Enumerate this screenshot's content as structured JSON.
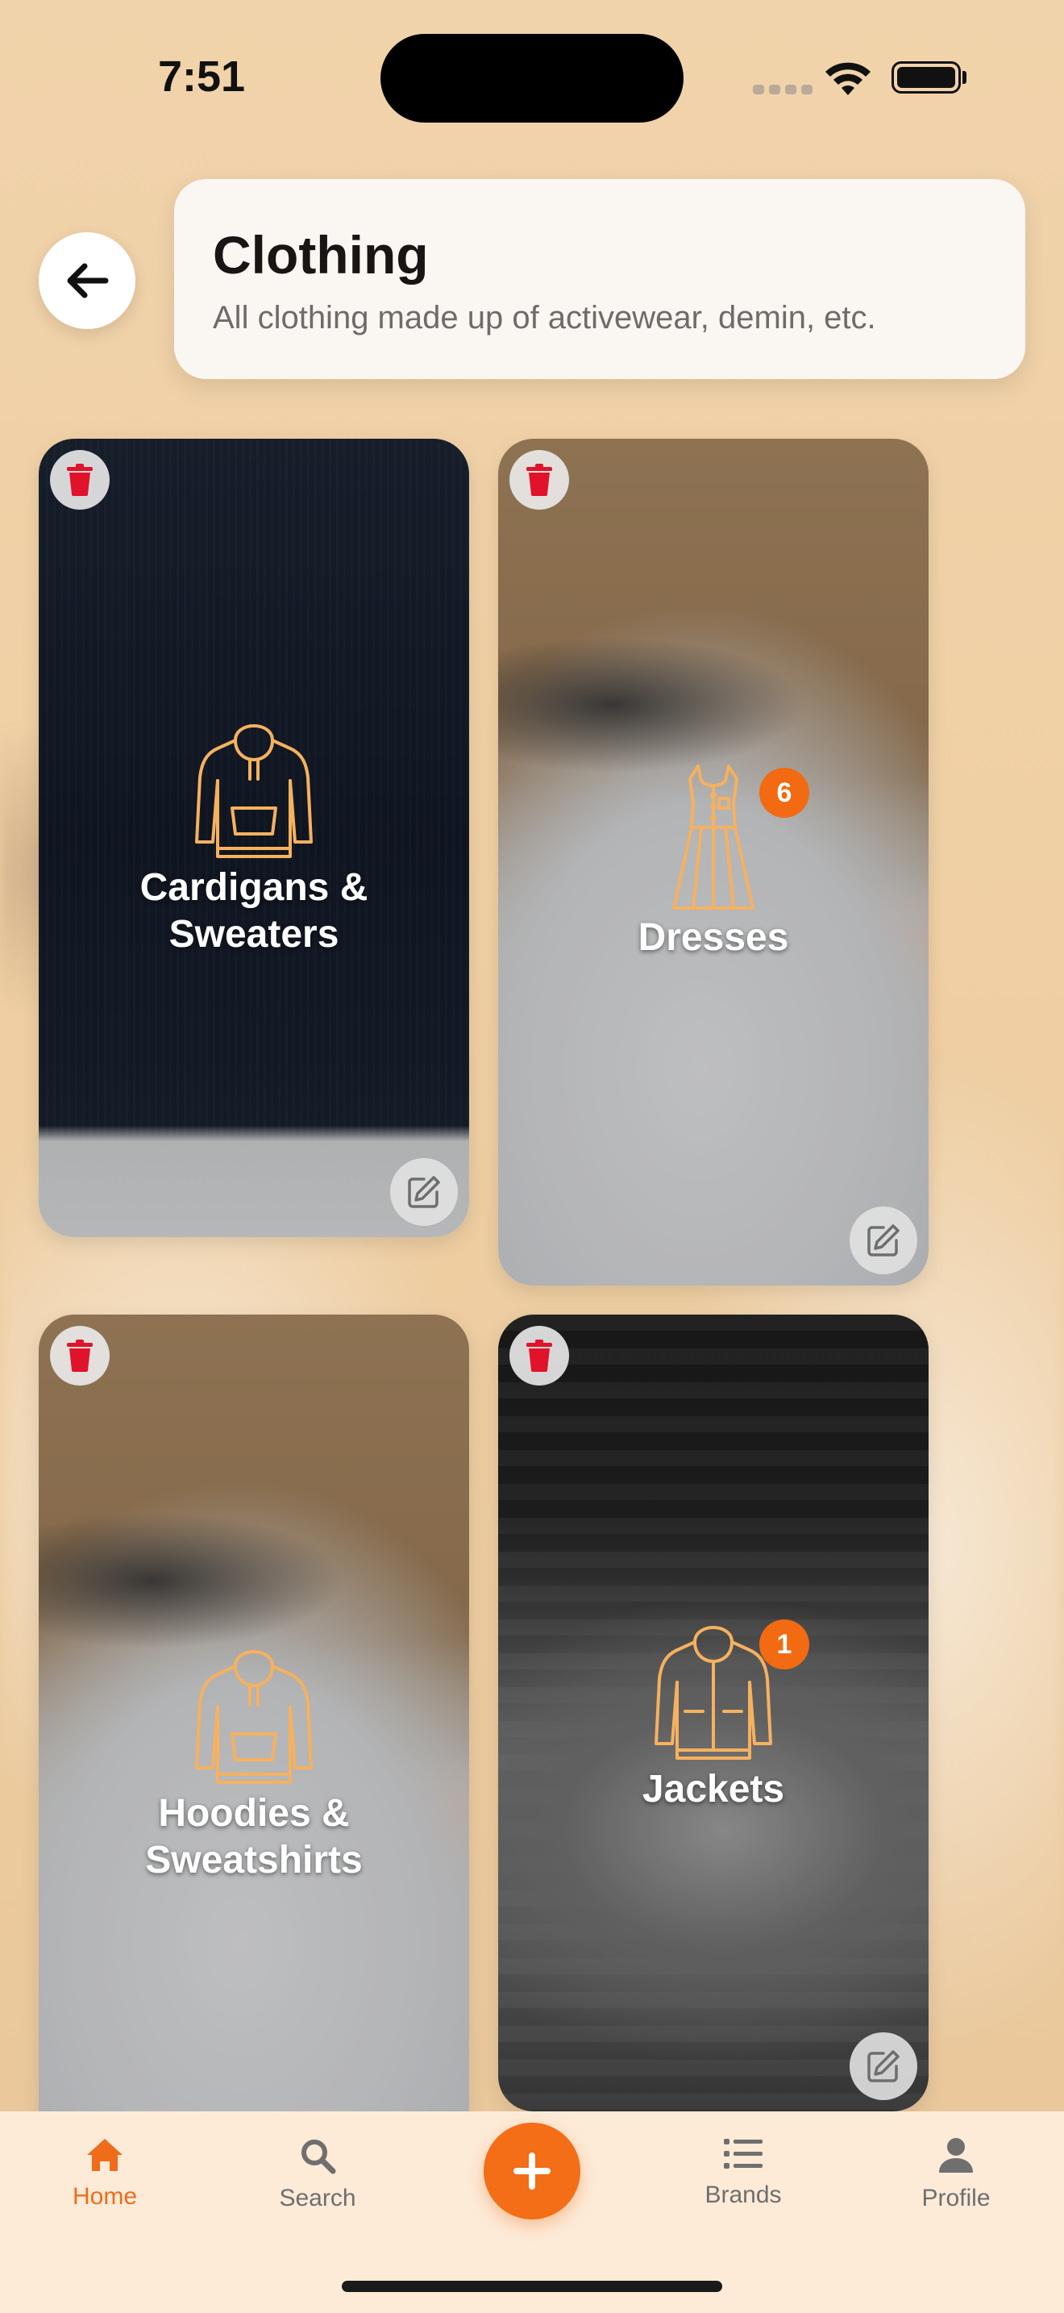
{
  "status_bar": {
    "time": "7:51"
  },
  "header": {
    "title": "Clothing",
    "subtitle": "All clothing made up of activewear, demin, etc."
  },
  "categories": [
    {
      "label": "Cardigans & Sweaters",
      "icon": "hoodie-icon",
      "count": null
    },
    {
      "label": "Dresses",
      "icon": "dress-icon",
      "count": "6"
    },
    {
      "label": "Hoodies & Sweatshirts",
      "icon": "hoodie-icon",
      "count": null
    },
    {
      "label": "Jackets",
      "icon": "jacket-icon",
      "count": "1"
    }
  ],
  "tabbar": {
    "home": "Home",
    "search": "Search",
    "brands": "Brands",
    "profile": "Profile"
  },
  "colors": {
    "accent": "#f46d17",
    "trash": "#e0132b"
  }
}
